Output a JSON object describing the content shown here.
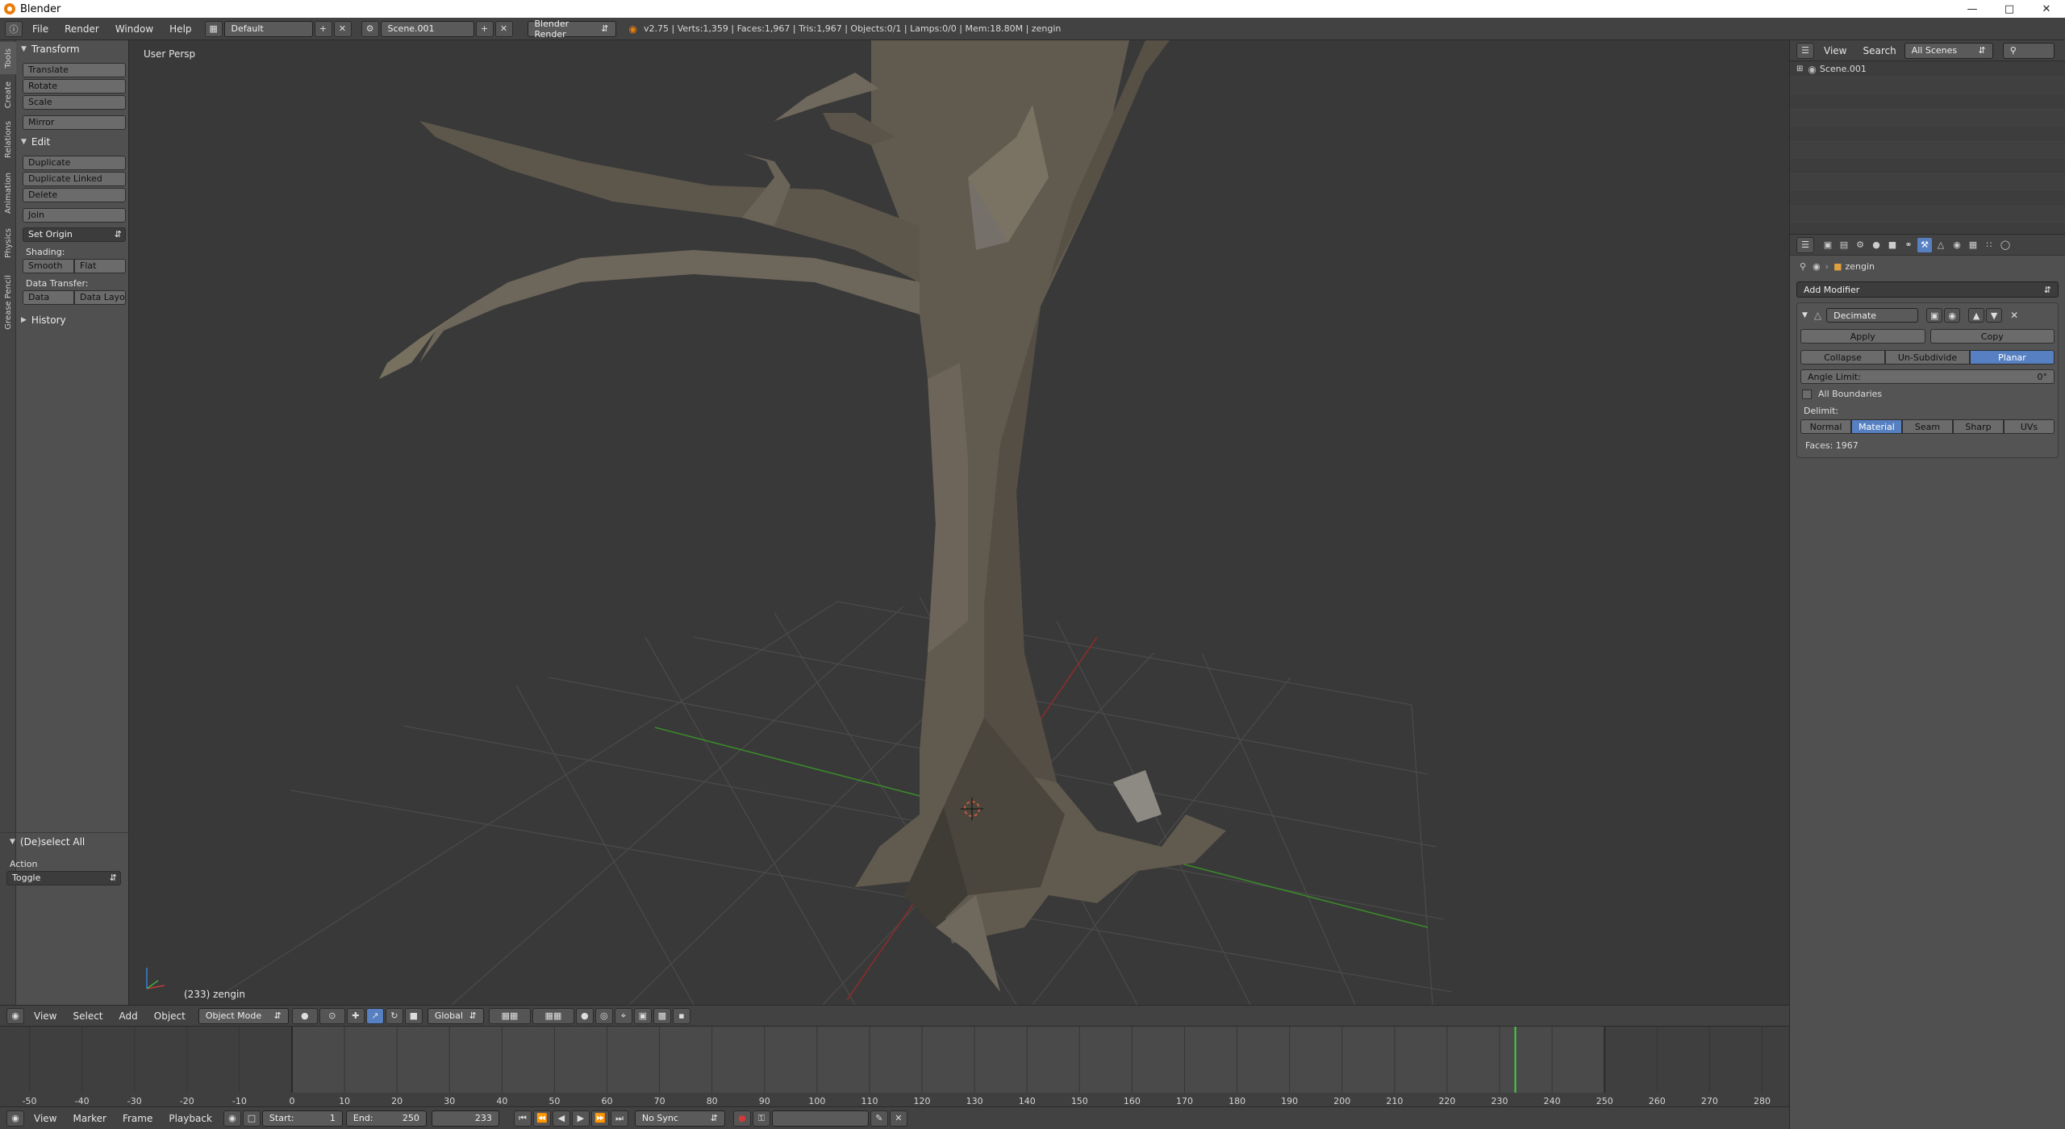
{
  "window": {
    "title": "Blender",
    "controls": [
      "minimize-icon",
      "maximize-icon",
      "close-icon"
    ]
  },
  "info_header": {
    "menus": [
      "File",
      "Render",
      "Window",
      "Help"
    ],
    "screen_layout": "Default",
    "scene": "Scene.001",
    "render_engine": "Blender Render",
    "stats": "v2.75 | Verts:1,359 | Faces:1,967 | Tris:1,967 | Objects:0/1 | Lamps:0/0 | Mem:18.80M | zengin"
  },
  "tool_tabs": [
    "Tools",
    "Create",
    "Relations",
    "Animation",
    "Physics",
    "Grease Pencil"
  ],
  "tools": {
    "transform_title": "Transform",
    "transform_buttons": [
      "Translate",
      "Rotate",
      "Scale"
    ],
    "mirror": "Mirror",
    "edit_title": "Edit",
    "edit_buttons": [
      "Duplicate",
      "Duplicate Linked",
      "Delete"
    ],
    "join": "Join",
    "set_origin": "Set Origin",
    "shading_label": "Shading:",
    "shading_smooth": "Smooth",
    "shading_flat": "Flat",
    "data_transfer_label": "Data Transfer:",
    "data_btn": "Data",
    "data_layo_btn": "Data Layo",
    "history_title": "History"
  },
  "operator_panel": {
    "title": "(De)select All",
    "action_label": "Action",
    "action_value": "Toggle"
  },
  "viewport": {
    "view_label": "User Persp",
    "object_info": "(233) zengin"
  },
  "view3d_header": {
    "menus": [
      "View",
      "Select",
      "Add",
      "Object"
    ],
    "mode": "Object Mode",
    "orientation": "Global"
  },
  "timeline": {
    "ticks": [
      "-50",
      "-40",
      "-30",
      "-20",
      "-10",
      "0",
      "10",
      "20",
      "30",
      "40",
      "50",
      "60",
      "70",
      "80",
      "90",
      "100",
      "110",
      "120",
      "130",
      "140",
      "150",
      "160",
      "170",
      "180",
      "190",
      "200",
      "210",
      "220",
      "230",
      "240",
      "250",
      "260",
      "270",
      "280"
    ],
    "current_frame": 233,
    "range_start": 0,
    "range_end": 250,
    "menus": [
      "View",
      "Marker",
      "Frame",
      "Playback"
    ],
    "start_label": "Start:",
    "start_value": "1",
    "end_label": "End:",
    "end_value": "250",
    "frame_value": "233",
    "sync": "No Sync"
  },
  "outliner": {
    "menus": [
      "View",
      "Search"
    ],
    "filter": "All Scenes",
    "items": [
      "Scene.001"
    ]
  },
  "properties": {
    "object_name": "zengin",
    "add_modifier": "Add Modifier",
    "modifier_name": "Decimate",
    "apply": "Apply",
    "copy": "Copy",
    "modes": [
      "Collapse",
      "Un-Subdivide",
      "Planar"
    ],
    "active_mode": "Planar",
    "angle_limit_label": "Angle Limit:",
    "angle_limit_value": "0°",
    "all_boundaries": "All Boundaries",
    "delimit_label": "Delimit:",
    "delimit_options": [
      "Normal",
      "Material",
      "Seam",
      "Sharp",
      "UVs"
    ],
    "active_delimit": "Material",
    "faces": "Faces: 1967"
  },
  "colors": {
    "accent": "#5680c2",
    "viewport_bg": "#393939",
    "playhead": "#3fd13f",
    "x_axis": "#8a2c2c",
    "y_axis": "#3a8a2a"
  }
}
